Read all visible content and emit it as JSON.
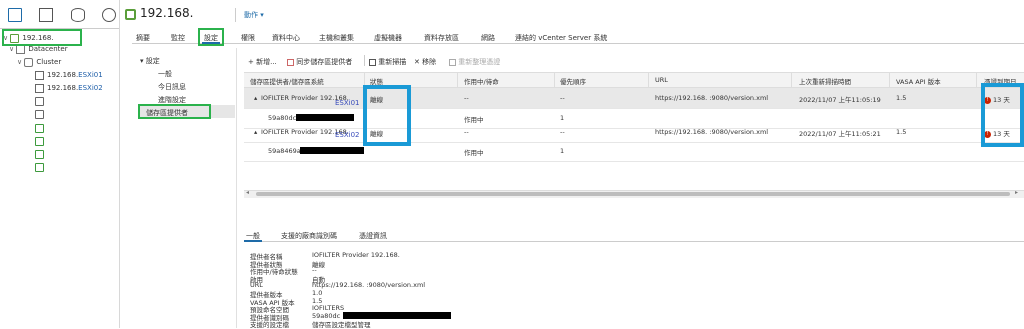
{
  "nav": {
    "tabs": [
      "hosts-clusters-icon",
      "vms-templates-icon",
      "storage-icon",
      "networking-icon"
    ],
    "tree": [
      {
        "label": "192.168.",
        "icon": "vcenter-icon",
        "suffix": ""
      },
      {
        "label": "Datacenter",
        "icon": "datacenter-icon",
        "suffix": ""
      },
      {
        "label": "Cluster",
        "icon": "cluster-icon",
        "suffix": ""
      },
      {
        "label": "192.168.",
        "icon": "host-icon",
        "suffix": "ESXi01"
      },
      {
        "label": "192.168.",
        "icon": "host-icon",
        "suffix": "ESXi02"
      }
    ]
  },
  "header": {
    "title": "192.168.",
    "actions": "動作 ▾"
  },
  "tabs": [
    "摘要",
    "監控",
    "設定",
    "權限",
    "資料中心",
    "主機和叢集",
    "虛擬機器",
    "資料存放區",
    "網路",
    "連結的 vCenter Server 系統"
  ],
  "settings": {
    "group": "設定",
    "items": [
      "一般",
      "今日訊息",
      "進階設定",
      "儲存區提供者"
    ]
  },
  "toolbar": {
    "add": "新增...",
    "sync": "同步儲存區提供者",
    "rescan": "重新掃描",
    "remove": "移除",
    "refresh_cert": "重新整理憑證"
  },
  "table": {
    "headers": [
      "儲存區提供者/儲存區系統",
      "狀態",
      "作用中/待命",
      "優先順序",
      "URL",
      "上次重新掃描時間",
      "VASA API 版本",
      "憑證到期日"
    ],
    "rows": [
      {
        "name": "IOFILTER Provider 192.168.",
        "status": "離線",
        "active": "--",
        "priority": "--",
        "url": "https://192.168.           :9080/version.xml",
        "rescan": "2022/11/07 上午11:05:19",
        "vasa": "1.5",
        "cert": "13 天"
      },
      {
        "name": "59a80dc",
        "status": "",
        "active": "作用中",
        "priority": "1",
        "url": "",
        "rescan": "",
        "vasa": "",
        "cert": ""
      },
      {
        "name": "IOFILTER Provider 192.168.",
        "status": "離線",
        "active": "--",
        "priority": "--",
        "url": "https://192.168.           :9080/version.xml",
        "rescan": "2022/11/07 上午11:05:21",
        "vasa": "1.5",
        "cert": "13 天"
      },
      {
        "name": "59a8469a",
        "status": "",
        "active": "作用中",
        "priority": "1",
        "url": "",
        "rescan": "",
        "vasa": "",
        "cert": ""
      }
    ],
    "annotations": [
      "ESXi01",
      "ESXi02"
    ]
  },
  "details": {
    "tabs": [
      "一般",
      "支援的廠商識別碼",
      "憑證資訊"
    ],
    "fields": [
      {
        "k": "提供者名稱",
        "v": "IOFILTER Provider 192.168."
      },
      {
        "k": "提供者狀態",
        "v": "離線"
      },
      {
        "k": "作用中/待命狀態",
        "v": "--"
      },
      {
        "k": "啟用",
        "v": "自動"
      },
      {
        "k": "URL",
        "v": "https://192.168.           :9080/version.xml"
      },
      {
        "k": "提供者版本",
        "v": "1.0"
      },
      {
        "k": "VASA API 版本",
        "v": "1.5"
      },
      {
        "k": "預設命名空間",
        "v": "IOFILTERS"
      },
      {
        "k": "提供者識別碼",
        "v": "59a80dc"
      },
      {
        "k": "支援的設定檔",
        "v": "儲存區設定檔型管理"
      }
    ]
  },
  "colors": {
    "highlight_green": "#2bb24c",
    "highlight_blue": "#1a9ad6",
    "warning_red": "#c92100",
    "link_blue": "#1e6ba8"
  }
}
